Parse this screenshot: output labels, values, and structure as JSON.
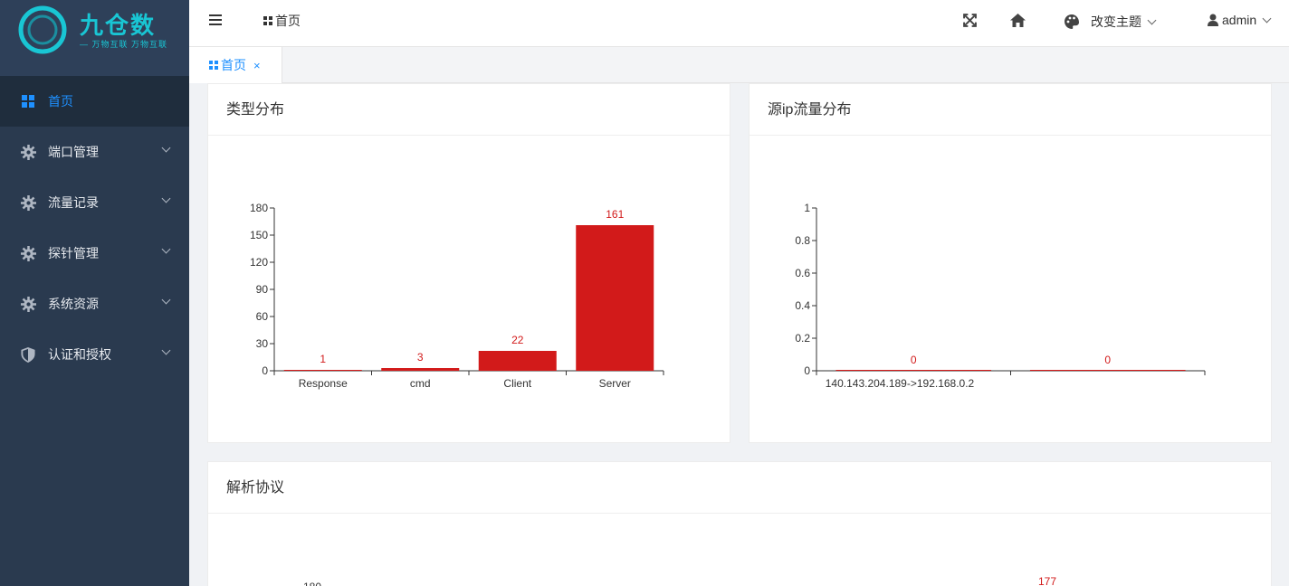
{
  "logo": {
    "name": "九仓数",
    "tagline": "— 万物互联 万物互联"
  },
  "sidebar": {
    "items": [
      {
        "label": "首页",
        "icon": "dashboard-icon",
        "active": true
      },
      {
        "label": "端口管理",
        "icon": "gear-icon"
      },
      {
        "label": "流量记录",
        "icon": "gear-icon"
      },
      {
        "label": "探针管理",
        "icon": "gear-icon"
      },
      {
        "label": "系统资源",
        "icon": "gear-icon"
      },
      {
        "label": "认证和授权",
        "icon": "shield-icon"
      }
    ]
  },
  "header": {
    "breadcrumb": "首页",
    "theme_label": "改变主题",
    "user": "admin",
    "icons": [
      "menu-icon",
      "fullscreen-icon",
      "home-icon",
      "palette-icon",
      "user-icon"
    ]
  },
  "tabs": [
    {
      "label": "首页",
      "close": "×"
    }
  ],
  "cards": {
    "type_dist": {
      "title": "类型分布"
    },
    "src_ip": {
      "title": "源ip流量分布"
    },
    "protocol": {
      "title": "解析协议"
    }
  },
  "colors": {
    "bar": "#d21a1a",
    "accent": "#1e90ff",
    "sidebar": "#2a3a4f"
  },
  "chart_data": [
    {
      "type": "bar",
      "title": "类型分布",
      "categories": [
        "Response",
        "cmd",
        "Client",
        "Server"
      ],
      "values": [
        1,
        3,
        22,
        161
      ],
      "ylim": [
        0,
        180
      ],
      "yticks": [
        0,
        30,
        60,
        90,
        120,
        150,
        180
      ]
    },
    {
      "type": "bar",
      "title": "源ip流量分布",
      "categories": [
        "140.143.204.189->192.168.0.2",
        ""
      ],
      "values": [
        0,
        0
      ],
      "ylim": [
        0,
        1
      ],
      "yticks": [
        0,
        0.2,
        0.4,
        0.6,
        0.8,
        1
      ]
    },
    {
      "type": "bar",
      "title": "解析协议",
      "categories": [],
      "values": [
        177
      ],
      "ylim": [
        0,
        180
      ]
    }
  ]
}
